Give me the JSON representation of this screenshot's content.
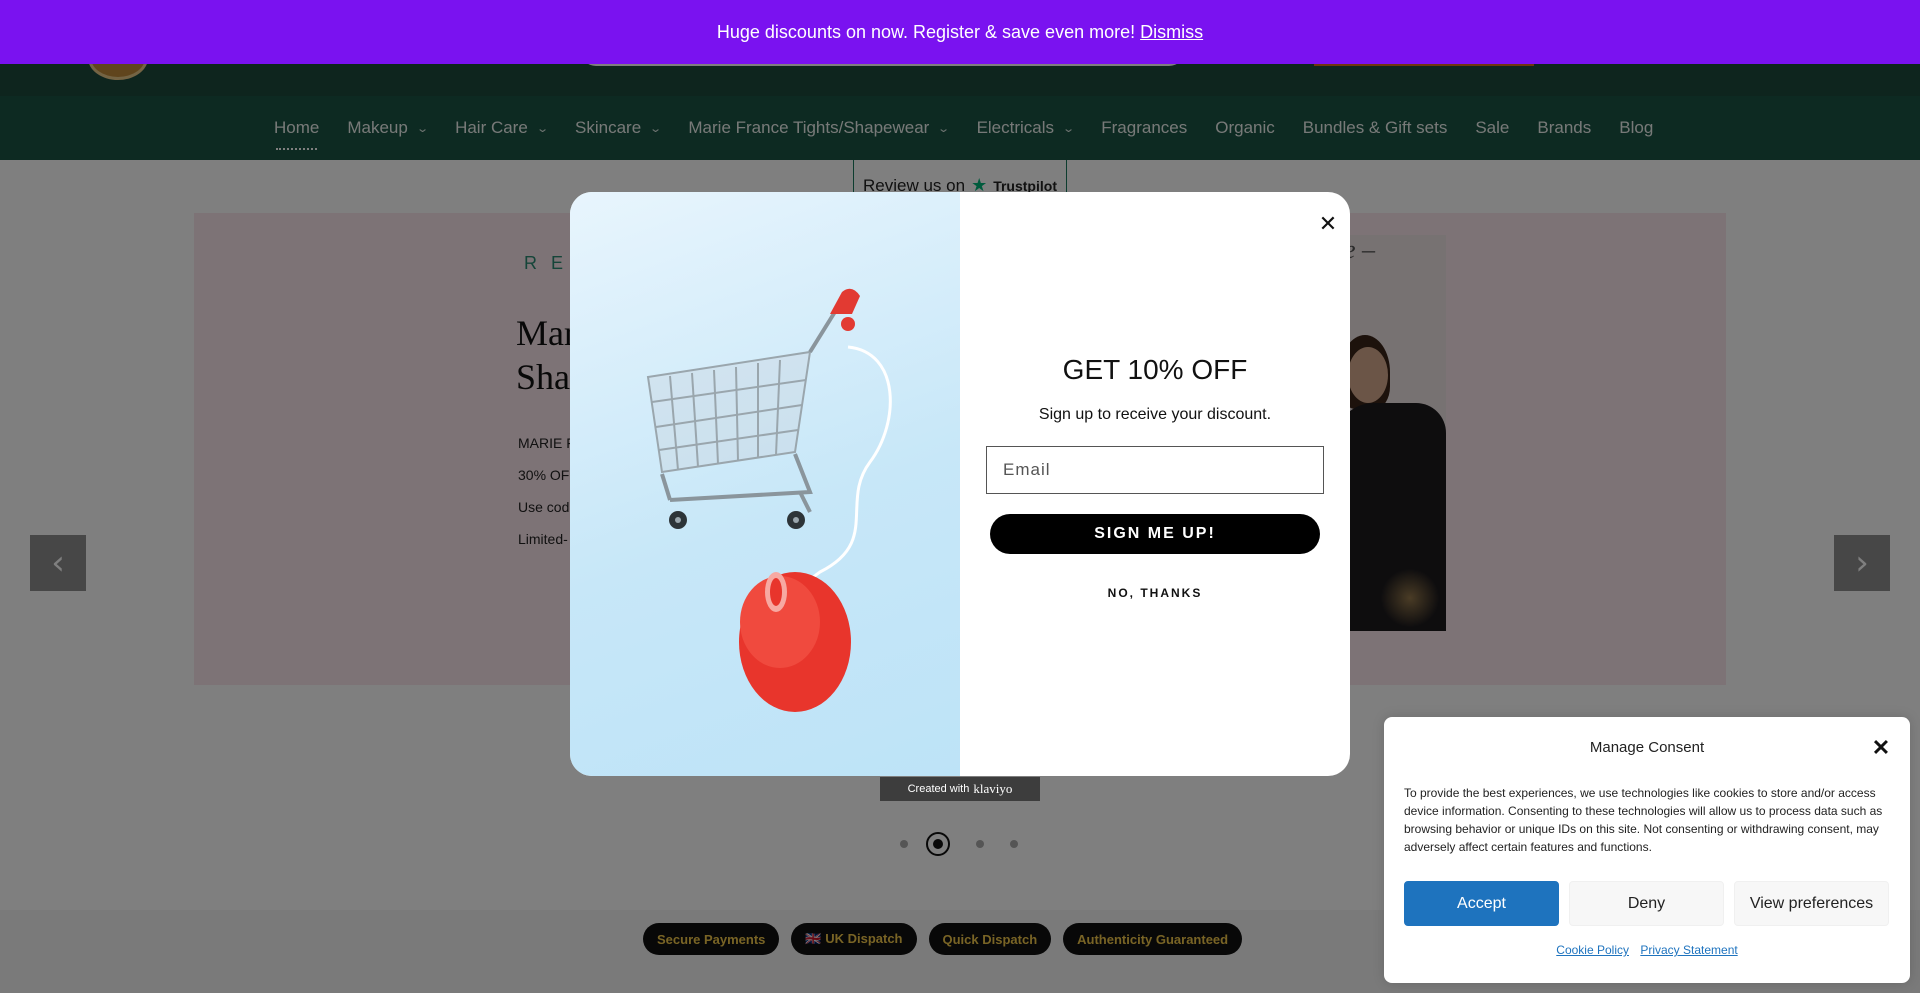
{
  "announcement": {
    "text": "Huge discounts on now. Register & save even more!",
    "dismiss_label": "Dismiss"
  },
  "nav": {
    "items": [
      {
        "label": "Home",
        "active": true,
        "has_dropdown": false
      },
      {
        "label": "Makeup",
        "has_dropdown": true
      },
      {
        "label": "Hair Care",
        "has_dropdown": true
      },
      {
        "label": "Skincare",
        "has_dropdown": true
      },
      {
        "label": "Marie France Tights/Shapewear",
        "has_dropdown": true
      },
      {
        "label": "Electricals",
        "has_dropdown": true
      },
      {
        "label": "Fragrances",
        "has_dropdown": false
      },
      {
        "label": "Organic",
        "has_dropdown": false
      },
      {
        "label": "Bundles & Gift sets",
        "has_dropdown": false
      },
      {
        "label": "Sale",
        "has_dropdown": false
      },
      {
        "label": "Brands",
        "has_dropdown": false
      },
      {
        "label": "Blog",
        "has_dropdown": false
      }
    ],
    "chevron_icon": "chevron-down-icon"
  },
  "trustpilot": {
    "prefix": "Review us on",
    "brand": "Trustpilot"
  },
  "hero": {
    "small_heading": "RE",
    "title_line1": "Mar",
    "title_line2": "Sha",
    "line1": "MARIE FR",
    "line2": "30% OFF",
    "line3": "Use code",
    "line4": "Limited-",
    "script_text": "e –",
    "prev_icon": "‹",
    "next_icon": "›"
  },
  "slider": {
    "total_slides": 4,
    "active_index": 1
  },
  "popup": {
    "title": "GET 10% OFF",
    "subtitle": "Sign up to receive your discount.",
    "email_placeholder": "Email",
    "signup_label": "SIGN ME UP!",
    "no_thanks_label": "NO, THANKS",
    "close_icon": "✕"
  },
  "klaviyo": {
    "prefix": "Created with",
    "brand": "klaviyo"
  },
  "badges": [
    {
      "label": "Secure Payments"
    },
    {
      "label": "🇬🇧 UK Dispatch"
    },
    {
      "label": "Quick Dispatch"
    },
    {
      "label": "Authenticity Guaranteed"
    }
  ],
  "consent": {
    "title": "Manage Consent",
    "close_icon": "✕",
    "text": "To provide the best experiences, we use technologies like cookies to store and/or access device information. Consenting to these technologies will allow us to process data such as browsing behavior or unique IDs on this site. Not consenting or withdrawing consent, may adversely affect certain features and functions.",
    "accept_label": "Accept",
    "deny_label": "Deny",
    "preferences_label": "View preferences",
    "cookie_policy_label": "Cookie Policy",
    "privacy_label": "Privacy Statement"
  },
  "colors": {
    "announcement_bg": "#7a12f0",
    "header_bg": "#1d4a3c",
    "nav_bg": "#1b5545",
    "hero_bg": "#fbe6ec",
    "accept_blue": "#1e73be",
    "badge_text": "#f2c84b"
  }
}
